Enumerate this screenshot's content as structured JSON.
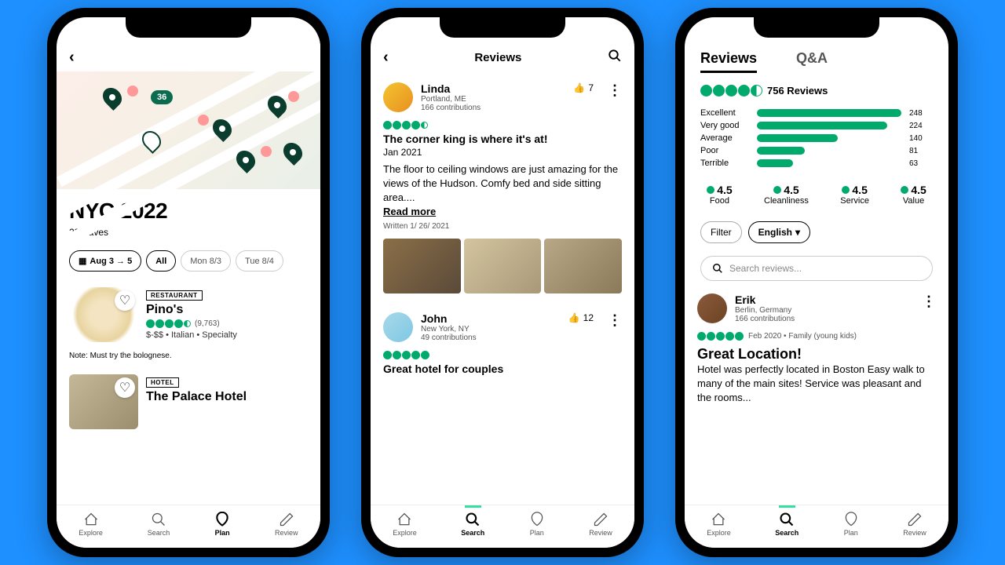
{
  "phone1": {
    "trip_title": "NYC 2022",
    "saves": "23 Saves",
    "chips": {
      "dates": "Aug 3 → 5",
      "all": "All",
      "mon": "Mon 8/3",
      "tue": "Tue 8/4"
    },
    "map_badge": "36",
    "card1": {
      "tag": "RESTAURANT",
      "title": "Pino's",
      "count": "(9,763)",
      "meta": "$-$$ • Italian • Specialty"
    },
    "note": "Note: Must try the bolognese.",
    "card2": {
      "tag": "HOTEL",
      "title": "The Palace Hotel"
    }
  },
  "phone2": {
    "title": "Reviews",
    "rev1": {
      "name": "Linda",
      "loc": "Portland, ME",
      "contrib": "166 contributions",
      "likes": "7",
      "title": "The corner king is where it's at!",
      "date": "Jan 2021",
      "text": "The floor to ceiling windows are just amazing for the views of the Hudson. Comfy bed and side sitting area....",
      "readmore": "Read more",
      "written": "Written 1/ 26/ 2021"
    },
    "rev2": {
      "name": "John",
      "loc": "New York, NY",
      "contrib": "49 contributions",
      "likes": "12",
      "title": "Great hotel for couples"
    }
  },
  "phone3": {
    "tabs": {
      "reviews": "Reviews",
      "qa": "Q&A"
    },
    "total": "756 Reviews",
    "bars": [
      {
        "label": "Excellent",
        "val": "248",
        "w": 100
      },
      {
        "label": "Very good",
        "val": "224",
        "w": 90
      },
      {
        "label": "Average",
        "val": "140",
        "w": 56
      },
      {
        "label": "Poor",
        "val": "81",
        "w": 33
      },
      {
        "label": "Terrible",
        "val": "63",
        "w": 25
      }
    ],
    "sub": [
      {
        "v": "4.5",
        "l": "Food"
      },
      {
        "v": "4.5",
        "l": "Cleanliness"
      },
      {
        "v": "4.5",
        "l": "Service"
      },
      {
        "v": "4.5",
        "l": "Value"
      }
    ],
    "filter": "Filter",
    "lang": "English",
    "search_ph": "Search reviews...",
    "rev": {
      "name": "Erik",
      "loc": "Berlin, Germany",
      "contrib": "166 contributions",
      "meta": "Feb 2020  •  Family (young kids)",
      "title": "Great Location!",
      "text": "Hotel was perfectly located in Boston Easy walk to many of the main sites! Service was pleasant and the rooms..."
    }
  },
  "nav": {
    "explore": "Explore",
    "search": "Search",
    "plan": "Plan",
    "review": "Review"
  }
}
